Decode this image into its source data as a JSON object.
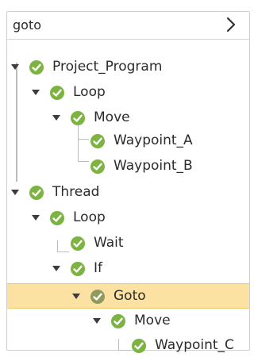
{
  "header": {
    "title": "goto",
    "chevron_icon": "chevron-right-icon"
  },
  "tree": {
    "status_icon": "check-circle-icon",
    "status_color": "#7cb342",
    "selected_status_color": "#8f9a5e",
    "selected_row_color": "#fbe2a3",
    "nodes": [
      {
        "label": "Project_Program",
        "expanded": true
      },
      {
        "label": "Loop",
        "expanded": true
      },
      {
        "label": "Move",
        "expanded": true
      },
      {
        "label": "Waypoint_A"
      },
      {
        "label": "Waypoint_B"
      },
      {
        "label": "Thread",
        "expanded": true
      },
      {
        "label": "Loop",
        "expanded": true
      },
      {
        "label": "Wait"
      },
      {
        "label": "If",
        "expanded": true
      },
      {
        "label": "Goto",
        "expanded": true,
        "selected": true
      },
      {
        "label": "Move",
        "expanded": true
      },
      {
        "label": "Waypoint_C"
      }
    ]
  }
}
